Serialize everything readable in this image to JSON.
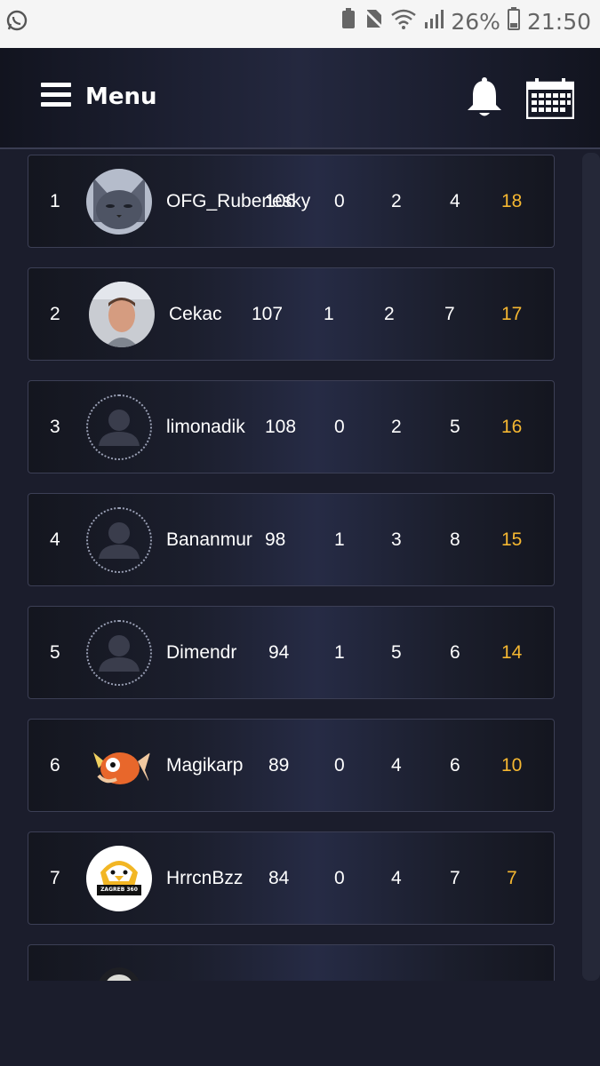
{
  "status_bar": {
    "battery": "26%",
    "time": "21:50"
  },
  "header": {
    "menu_label": "Menu"
  },
  "standings": [
    {
      "rank": "1",
      "name": "OFG_Rubenesky",
      "a": "106",
      "b": "0",
      "c": "2",
      "d": "4",
      "pts": "18",
      "avatar": "cat-photo"
    },
    {
      "rank": "2",
      "name": "Cekac",
      "a": "107",
      "b": "1",
      "c": "2",
      "d": "7",
      "pts": "17",
      "avatar": "person-photo"
    },
    {
      "rank": "3",
      "name": "limonadik",
      "a": "108",
      "b": "0",
      "c": "2",
      "d": "5",
      "pts": "16",
      "avatar": "default-avatar"
    },
    {
      "rank": "4",
      "name": "Bananmur",
      "a": "98",
      "b": "1",
      "c": "3",
      "d": "8",
      "pts": "15",
      "avatar": "default-avatar"
    },
    {
      "rank": "5",
      "name": "Dimendr",
      "a": "94",
      "b": "1",
      "c": "5",
      "d": "6",
      "pts": "14",
      "avatar": "default-avatar"
    },
    {
      "rank": "6",
      "name": "Magikarp",
      "a": "89",
      "b": "0",
      "c": "4",
      "d": "6",
      "pts": "10",
      "avatar": "fish-logo"
    },
    {
      "rank": "7",
      "name": "HrrcnBzz",
      "a": "84",
      "b": "0",
      "c": "4",
      "d": "7",
      "pts": "7",
      "avatar": "eagle-logo",
      "logo_text": "ZAGREB 360"
    }
  ],
  "colors": {
    "points": "#f5b731",
    "background": "#1b1d2c"
  },
  "icons": {
    "menu": "hamburger-icon",
    "notifications": "bell-icon",
    "calendar": "calendar-icon"
  }
}
